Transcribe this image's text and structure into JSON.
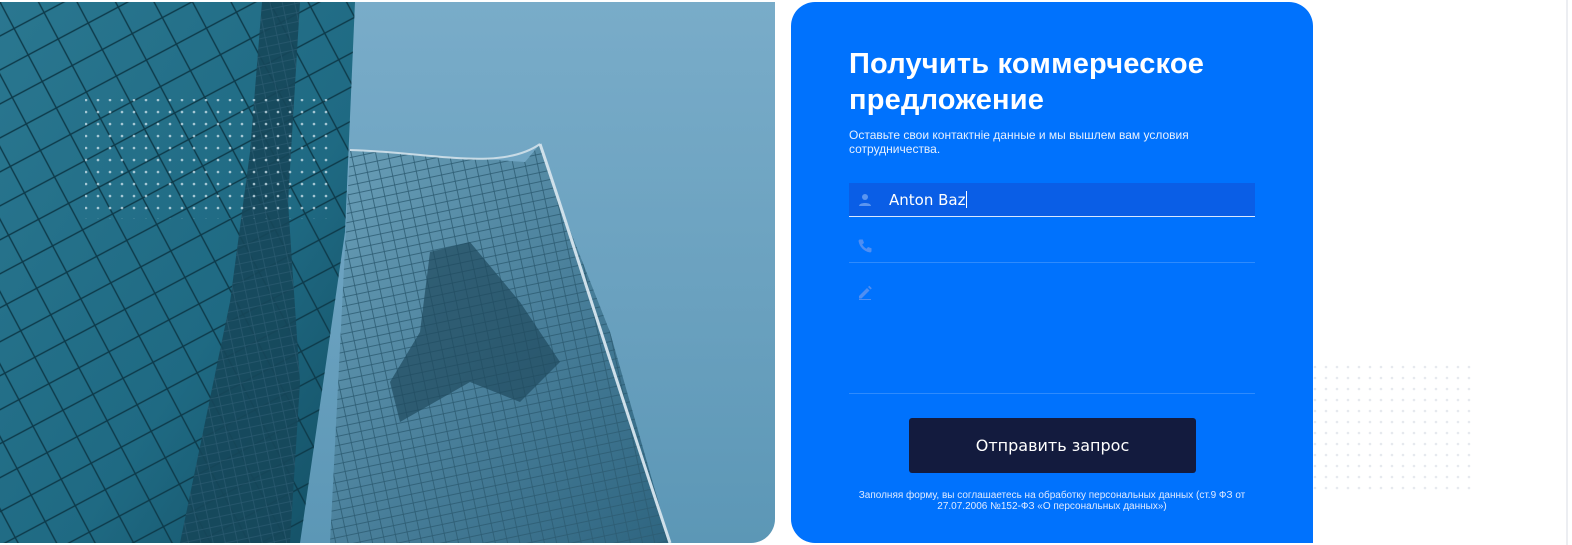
{
  "form": {
    "title": "Получить коммерческое предложение",
    "subtitle": "Оставьте свои контактніе данные и мы вышлем вам условия сотрудничества.",
    "fields": [
      {
        "icon": "user-icon",
        "value": "Anton Baz",
        "active": true
      },
      {
        "icon": "phone-icon",
        "value": "",
        "active": false
      },
      {
        "icon": "pencil-icon",
        "value": "",
        "active": false
      }
    ],
    "submit_label": "Отправить запрос",
    "consent": "Заполняя форму, вы соглашаетесь на обработку персональных данных (ст.9 ФЗ от 27.07.2006 №152-ФЗ «О персональных данных»)"
  },
  "colors": {
    "panel": "#0072fd",
    "active_field": "#0a5ee6",
    "button": "#131b3e"
  }
}
